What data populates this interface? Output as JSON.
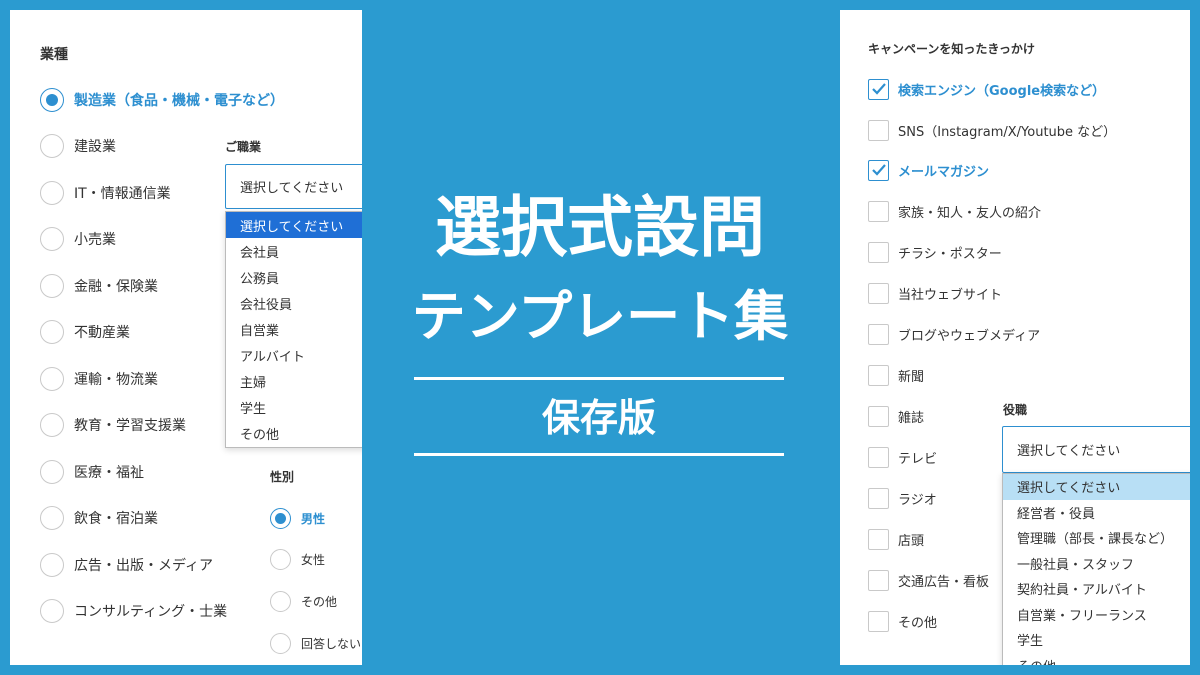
{
  "left": {
    "industry_heading": "業種",
    "industries": [
      "製造業（食品・機械・電子など）",
      "建設業",
      "IT・情報通信業",
      "小売業",
      "金融・保険業",
      "不動産業",
      "運輸・物流業",
      "教育・学習支援業",
      "医療・福祉",
      "飲食・宿泊業",
      "広告・出版・メディア",
      "コンサルティング・士業"
    ],
    "occupation_heading": "ご職業",
    "occupation_select_value": "選択してください",
    "occupation_options": [
      "選択してください",
      "会社員",
      "公務員",
      "会社役員",
      "自営業",
      "アルバイト",
      "主婦",
      "学生",
      "その他"
    ],
    "gender_heading": "性別",
    "genders": [
      "男性",
      "女性",
      "その他",
      "回答しない"
    ]
  },
  "center": {
    "title_line1": "選択式設問",
    "title_line2": "テンプレート集",
    "subtitle": "保存版"
  },
  "right": {
    "campaign_heading": "キャンペーンを知ったきっかけ",
    "campaign_options": [
      "検索エンジン（Google検索など）",
      "SNS（Instagram/X/Youtube など）",
      "メールマガジン",
      "家族・知人・友人の紹介",
      "チラシ・ポスター",
      "当社ウェブサイト",
      "ブログやウェブメディア",
      "新聞",
      "雑誌",
      "テレビ",
      "ラジオ",
      "店頭",
      "交通広告・看板",
      "その他"
    ],
    "position_heading": "役職",
    "position_select_value": "選択してください",
    "position_options": [
      "選択してください",
      "経営者・役員",
      "管理職（部長・課長など）",
      "一般社員・スタッフ",
      "契約社員・アルバイト",
      "自営業・フリーランス",
      "学生",
      "その他"
    ]
  },
  "colors": {
    "background": "#2b9bd0",
    "accent": "#2d8fd0",
    "highlight_dark": "#1f6fd6",
    "highlight_light": "#b8dff5"
  }
}
